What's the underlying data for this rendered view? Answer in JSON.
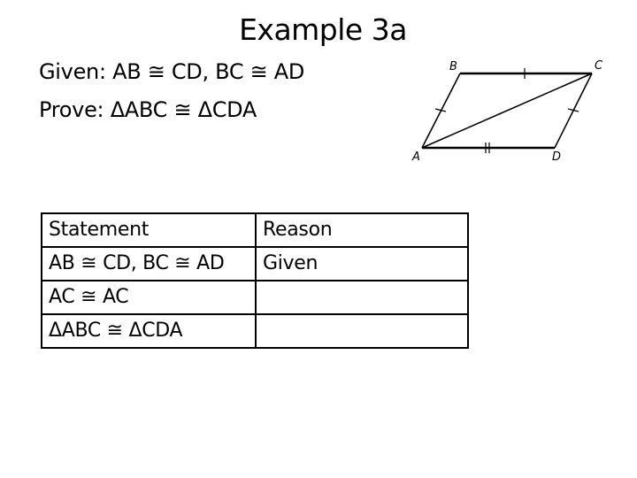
{
  "title": "Example 3a",
  "given": {
    "label": "Given:",
    "text": "AB ≅ CD, BC ≅ AD"
  },
  "prove": {
    "label": "Prove:",
    "text": "ΔABC ≅ ΔCDA"
  },
  "diagram": {
    "shape": "parallelogram",
    "vertices": {
      "A": "A",
      "B": "B",
      "C": "C",
      "D": "D"
    },
    "segments": [
      "AB",
      "BC",
      "CD",
      "DA",
      "AC"
    ],
    "tick_marks": {
      "AB": 1,
      "BC": 1,
      "CD": 1,
      "AD": 2
    }
  },
  "table": {
    "headers": [
      "Statement",
      "Reason"
    ],
    "rows": [
      {
        "statement": "AB ≅ CD, BC ≅ AD",
        "reason": "Given"
      },
      {
        "statement": "AC ≅ AC",
        "reason": ""
      },
      {
        "statement": "ΔABC ≅ ΔCDA",
        "reason": ""
      }
    ]
  }
}
